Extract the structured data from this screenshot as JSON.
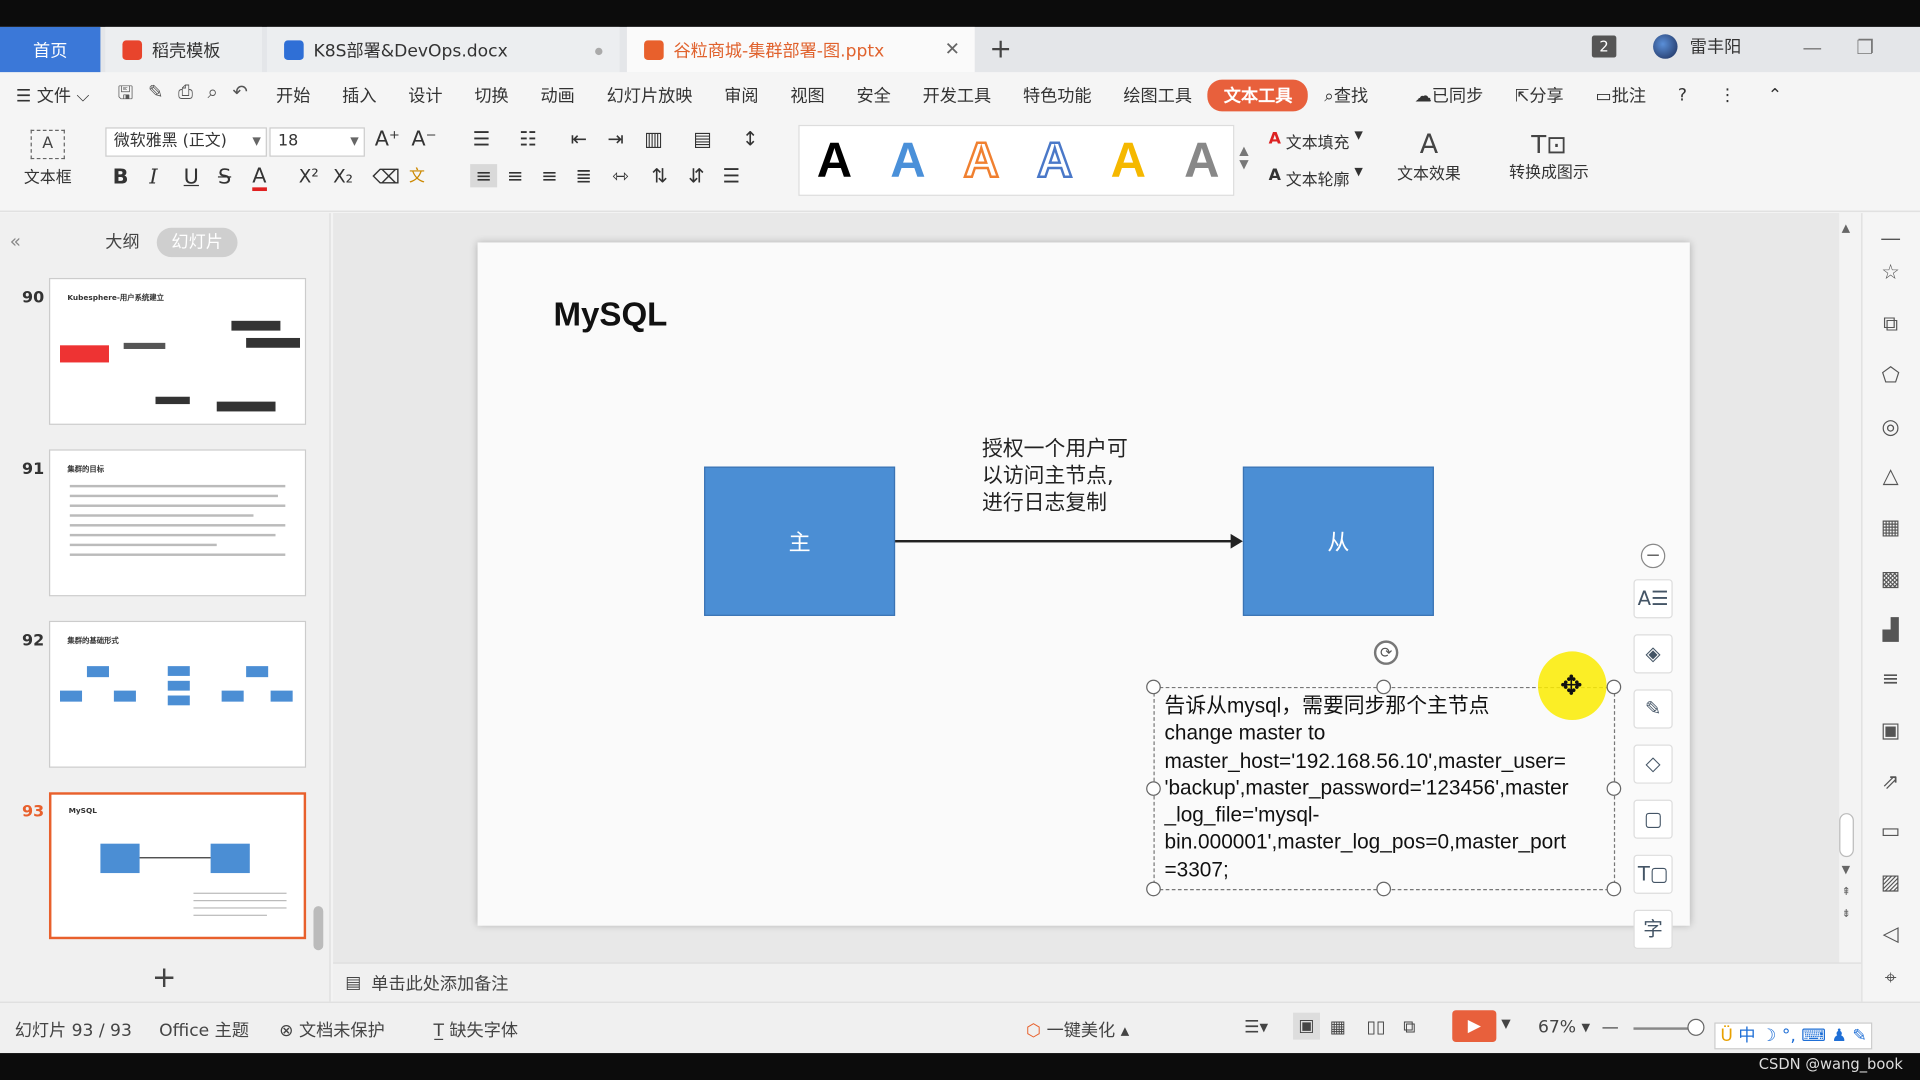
{
  "tabs": {
    "home": "首页",
    "docer": "稻壳模板",
    "docx": "K8S部署&DevOps.docx",
    "pptx": "谷粒商城-集群部署-图.pptx",
    "new_tab": "+"
  },
  "titlebar": {
    "badge": "2",
    "user": "雷丰阳"
  },
  "menu": {
    "file": "文件",
    "items": [
      "开始",
      "插入",
      "设计",
      "切换",
      "动画",
      "幻灯片放映",
      "审阅",
      "视图",
      "安全",
      "开发工具",
      "特色功能",
      "绘图工具"
    ],
    "active": "文本工具",
    "search": "查找",
    "sync": "已同步",
    "share": "分享",
    "comment": "批注"
  },
  "ribbon": {
    "textbox": "文本框",
    "font_name": "微软雅黑 (正文)",
    "font_size": "18",
    "bold": "B",
    "italic": "I",
    "underline": "U",
    "strike": "S",
    "font_color": "A",
    "big_a": "A",
    "text_fill": "文本填充",
    "text_outline": "文本轮廓",
    "text_effect": "文本效果",
    "convert": "转换成图示"
  },
  "left_panel": {
    "outline_tab": "大纲",
    "slides_tab": "幻灯片",
    "slides": [
      {
        "num": "90",
        "title": "Kubesphere-用户系统建立"
      },
      {
        "num": "91",
        "title": "集群的目标"
      },
      {
        "num": "92",
        "title": "集群的基础形式"
      },
      {
        "num": "93",
        "title": "MySQL"
      }
    ],
    "add": "+"
  },
  "slide": {
    "title": "MySQL",
    "master_label": "主",
    "slave_label": "从",
    "arrow_label_lines": [
      "授权一个用户可",
      "以访问主节点,",
      "进行日志复制"
    ],
    "textbox_lines": [
      "告诉从mysql，需要同步那个主节点",
      "change master to",
      "master_host='192.168.56.10',master_user=",
      "'backup',master_password='123456',master",
      "_log_file='mysql-",
      "bin.000001',master_log_pos=0,master_port",
      "=3307;"
    ]
  },
  "notes_placeholder": "单击此处添加备注",
  "status": {
    "slide_count": "幻灯片 93 / 93",
    "theme": "Office 主题",
    "protect": "文档未保护",
    "missing_font": "缺失字体",
    "beautify": "一键美化",
    "zoom": "67%",
    "ime": "中",
    "watermark": "CSDN @wang_book"
  },
  "colors": {
    "accent": "#e8603c",
    "box_fill": "#4b8ed4",
    "tab_home": "#3b78d8"
  }
}
